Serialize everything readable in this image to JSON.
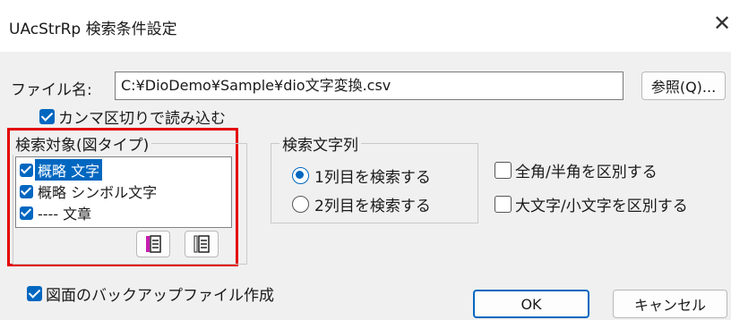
{
  "window": {
    "title": "UAcStrRp  検索条件設定",
    "close_glyph": "✕"
  },
  "file": {
    "label": "ファイル名:",
    "path": "C:¥DioDemo¥Sample¥dio文字変換.csv",
    "browse_label": "参照(Q)..."
  },
  "comma_option": {
    "label": "カンマ区切りで読み込む",
    "checked": true
  },
  "search_target": {
    "title": "検索対象(図タイプ)",
    "items": [
      {
        "text": "概略  文字",
        "checked": true,
        "selected": true
      },
      {
        "text": "概略  シンボル文字",
        "checked": true,
        "selected": false
      },
      {
        "text": "----  文章",
        "checked": true,
        "selected": false
      }
    ],
    "icon_buttons": [
      "select-all-icon",
      "deselect-all-icon"
    ],
    "accent_color": "#e30000"
  },
  "search_column": {
    "title": "検索文字列",
    "options": [
      {
        "label": "1列目を検索する",
        "selected": true
      },
      {
        "label": "2列目を検索する",
        "selected": false
      }
    ]
  },
  "options": {
    "fullwidth": {
      "label": "全角/半角を区別する",
      "checked": false
    },
    "case": {
      "label": "大文字/小文字を区別する",
      "checked": false
    }
  },
  "backup": {
    "label": "図面のバックアップファイル作成",
    "checked": true
  },
  "buttons": {
    "ok": "OK",
    "cancel": "キャンセル"
  },
  "colors": {
    "accent": "#0067c0",
    "highlight": "#e30000"
  }
}
